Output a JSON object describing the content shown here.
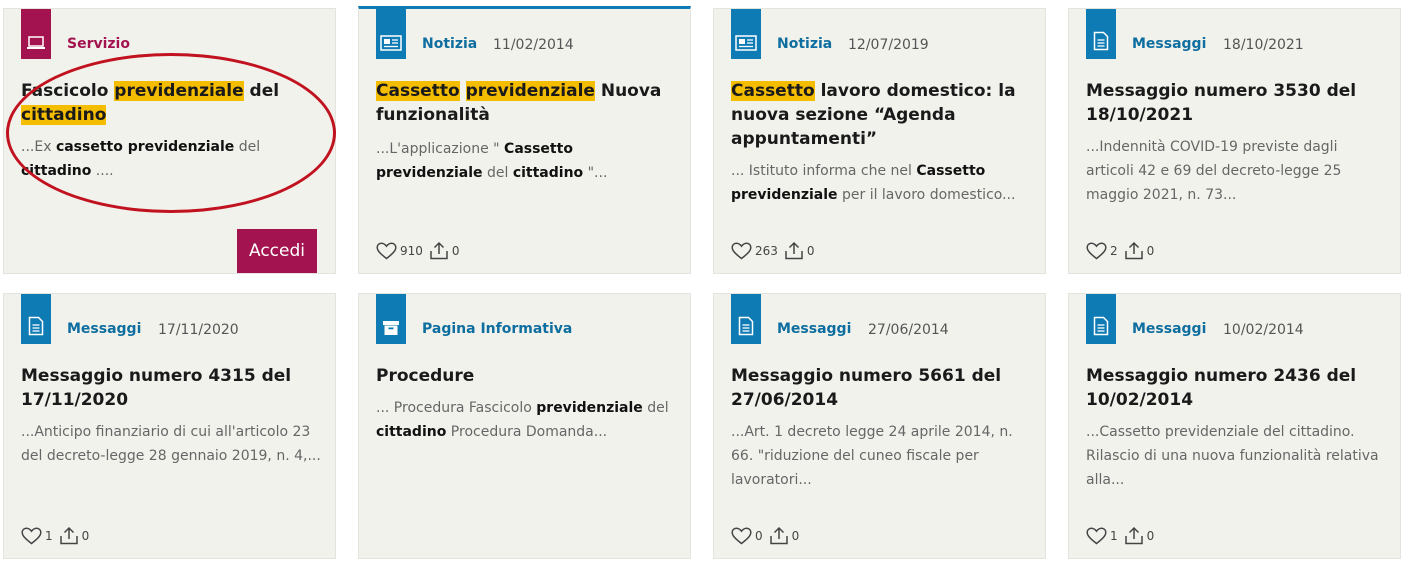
{
  "cards": [
    {
      "type": "Servizio",
      "title_parts": [
        {
          "t": "Fascicolo ",
          "hl": false
        },
        {
          "t": "previdenziale",
          "hl": true
        },
        {
          "t": " del ",
          "hl": false
        },
        {
          "t": "cittadino",
          "hl": true
        }
      ],
      "excerpt_parts": [
        {
          "t": "...Ex ",
          "b": false
        },
        {
          "t": "cassetto previdenziale",
          "b": true
        },
        {
          "t": " del ",
          "b": false
        },
        {
          "t": "cittadino",
          "b": true
        },
        {
          "t": " ....",
          "b": false
        }
      ],
      "button": "Accedi"
    },
    {
      "type": "Notizia",
      "date": "11/02/2014",
      "title_parts": [
        {
          "t": "Cassetto",
          "hl": true
        },
        {
          "t": " ",
          "hl": false
        },
        {
          "t": "previdenziale",
          "hl": true
        },
        {
          "t": " Nuova funzionalità",
          "hl": false
        }
      ],
      "excerpt_parts": [
        {
          "t": "...L'applicazione \" ",
          "b": false
        },
        {
          "t": "Cassetto previdenziale",
          "b": true
        },
        {
          "t": " del ",
          "b": false
        },
        {
          "t": "cittadino",
          "b": true
        },
        {
          "t": " \"...",
          "b": false
        }
      ],
      "likes": "910",
      "shares": "0"
    },
    {
      "type": "Notizia",
      "date": "12/07/2019",
      "title_parts": [
        {
          "t": "Cassetto",
          "hl": true
        },
        {
          "t": " lavoro domestico: la nuova sezione “Agenda appuntamenti”",
          "hl": false
        }
      ],
      "excerpt_parts": [
        {
          "t": "... Istituto informa che nel ",
          "b": false
        },
        {
          "t": "Cassetto previdenziale",
          "b": true
        },
        {
          "t": " per il lavoro domestico...",
          "b": false
        }
      ],
      "likes": "263",
      "shares": "0"
    },
    {
      "type": "Messaggi",
      "date": "18/10/2021",
      "title_parts": [
        {
          "t": "Messaggio numero 3530 del 18/10/2021",
          "hl": false
        }
      ],
      "excerpt_parts": [
        {
          "t": "...Indennità COVID-19 previste dagli articoli 42 e 69 del decreto-legge 25 maggio 2021, n. 73...",
          "b": false
        }
      ],
      "likes": "2",
      "shares": "0"
    },
    {
      "type": "Messaggi",
      "date": "17/11/2020",
      "title_parts": [
        {
          "t": "Messaggio numero 4315 del 17/11/2020",
          "hl": false
        }
      ],
      "excerpt_parts": [
        {
          "t": "...Anticipo finanziario di cui all'articolo 23 del decreto-legge 28 gennaio 2019, n. 4,...",
          "b": false
        }
      ],
      "likes": "1",
      "shares": "0"
    },
    {
      "type": "Pagina Informativa",
      "title_parts": [
        {
          "t": "Procedure",
          "hl": false
        }
      ],
      "excerpt_parts": [
        {
          "t": "... Procedura Fascicolo ",
          "b": false
        },
        {
          "t": "previdenziale",
          "b": true
        },
        {
          "t": " del ",
          "b": false
        },
        {
          "t": "cittadino",
          "b": true
        },
        {
          "t": " Procedura Domanda...",
          "b": false
        }
      ]
    },
    {
      "type": "Messaggi",
      "date": "27/06/2014",
      "title_parts": [
        {
          "t": "Messaggio numero 5661 del 27/06/2014",
          "hl": false
        }
      ],
      "excerpt_parts": [
        {
          "t": "...Art. 1 decreto legge 24 aprile 2014, n. 66. \"riduzione del cuneo fiscale per lavoratori...",
          "b": false
        }
      ],
      "likes": "0",
      "shares": "0"
    },
    {
      "type": "Messaggi",
      "date": "10/02/2014",
      "title_parts": [
        {
          "t": "Messaggio numero 2436 del 10/02/2014",
          "hl": false
        }
      ],
      "excerpt_parts": [
        {
          "t": "...Cassetto previdenziale del cittadino. Rilascio di una nuova funzionalità relativa alla...",
          "b": false
        }
      ],
      "likes": "1",
      "shares": "0"
    }
  ],
  "colors": {
    "accent_blue": "#0e7bb5",
    "servizio_magenta": "#a3134f",
    "highlight": "#f5bd00",
    "annotation_red": "#c1121f",
    "card_bg": "#f2f2ed"
  },
  "icons": {
    "servizio": "laptop-icon",
    "notizia": "newspaper-icon",
    "messaggi": "document-icon",
    "pagina_informativa": "archive-box-icon",
    "like": "heart-icon",
    "share": "share-icon"
  }
}
